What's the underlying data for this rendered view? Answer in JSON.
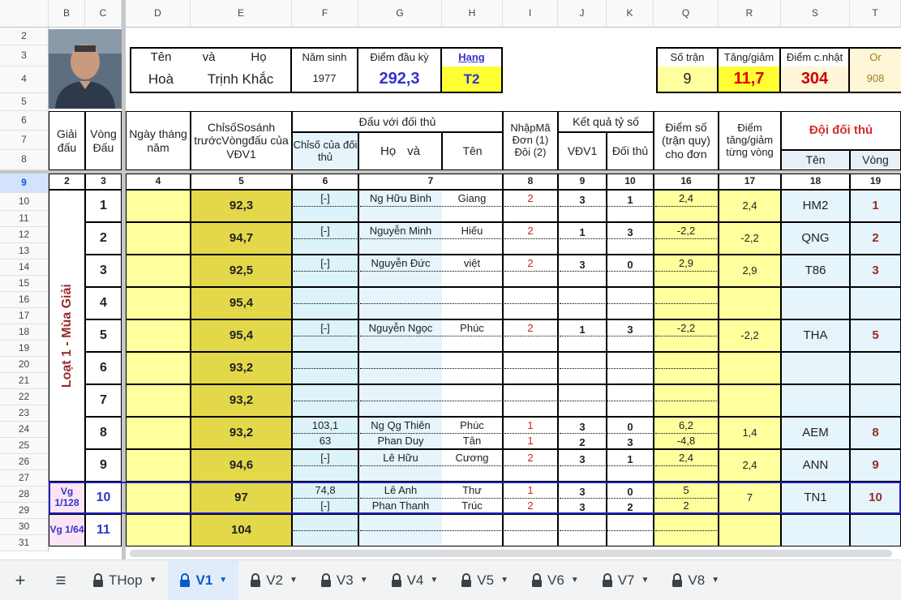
{
  "columns": [
    {
      "id": "col-b",
      "label": "B"
    },
    {
      "id": "col-c",
      "label": "C"
    },
    {
      "id": "col-d",
      "label": "D"
    },
    {
      "id": "col-e",
      "label": "E"
    },
    {
      "id": "col-f",
      "label": "F"
    },
    {
      "id": "col-g",
      "label": "G"
    },
    {
      "id": "col-h",
      "label": "H"
    },
    {
      "id": "col-i",
      "label": "I"
    },
    {
      "id": "col-j",
      "label": "J"
    },
    {
      "id": "col-k",
      "label": "K"
    },
    {
      "id": "col-q",
      "label": "Q"
    },
    {
      "id": "col-r",
      "label": "R"
    },
    {
      "id": "col-s",
      "label": "S"
    },
    {
      "id": "col-t",
      "label": "T"
    }
  ],
  "rows": [
    "2",
    "3",
    "4",
    "5",
    "6",
    "7",
    "8",
    "9",
    "10",
    "11",
    "12",
    "13",
    "14",
    "15",
    "16",
    "17",
    "18",
    "19",
    "20",
    "21",
    "22",
    "23",
    "24",
    "25",
    "26",
    "27",
    "28",
    "29",
    "30",
    "31"
  ],
  "player": {
    "name_label_ten": "Tên",
    "name_label_va": "và",
    "name_label_ho": "Họ",
    "first_name": "Hoà",
    "last_name": "Trịnh Khắc",
    "birth_year_label": "Năm sinh",
    "birth_year": "1977",
    "start_points_label": "Điểm đầu kỳ",
    "start_points": "292,3",
    "rank_label": "Hạng",
    "rank": "T2"
  },
  "summary": {
    "matches_label": "Số trận",
    "matches": "9",
    "change_label": "Tăng/giảm",
    "change": "11,7",
    "updated_label": "Điểm c.nhật",
    "updated": "304",
    "or_label": "Or",
    "or_value": "908"
  },
  "headers": {
    "giai_dau": "Giải đấu",
    "vong_dau": "Vòng Đấu",
    "ngay": "Ngày tháng năm",
    "chiso": "ChỉsốSosánh trướcVòngđấu của VĐV1",
    "dau_voi": "Đấu với đối thủ",
    "chiso_doi_thu": "Chỉsố của đối thủ",
    "ho": "Họ",
    "va": "và",
    "ten": "Tên",
    "nhap_ma": "NhậpMã Đơn (1) Đôi (2)",
    "ket_qua": "Kết quả tỷ số",
    "vdv1": "VĐV1",
    "doi_thu": "Đối thủ",
    "diem_so": "Điểm số (trận quy) cho đơn",
    "diem_tang": "Điểm tăng/giảm từng vòng",
    "doi_doi_thu": "Đội đối thủ",
    "ten_doi": "Tên",
    "vong": "Vòng"
  },
  "col_numbers": [
    "2",
    "3",
    "4",
    "5",
    "6",
    "7",
    "8",
    "9",
    "10",
    "16",
    "17",
    "18",
    "19"
  ],
  "season_label": "Loạt 1 - Mùa Giải",
  "rounds": [
    {
      "round": "1",
      "index": "92,3",
      "opp": [
        {
          "idx": "[-]",
          "ho": "Ng Hữu Bình",
          "ten": "Giang",
          "code": "2",
          "a": "3",
          "b": "1",
          "pts": "2,4"
        }
      ],
      "delta": "2,4",
      "team": "HM2",
      "vong": "1"
    },
    {
      "round": "2",
      "index": "94,7",
      "opp": [
        {
          "idx": "[-]",
          "ho": "Nguyễn Minh",
          "ten": "Hiếu",
          "code": "2",
          "a": "1",
          "b": "3",
          "pts": "-2,2"
        }
      ],
      "delta": "-2,2",
      "team": "QNG",
      "vong": "2"
    },
    {
      "round": "3",
      "index": "92,5",
      "opp": [
        {
          "idx": "[-]",
          "ho": "Nguyễn Đức",
          "ten": "việt",
          "code": "2",
          "a": "3",
          "b": "0",
          "pts": "2,9"
        }
      ],
      "delta": "2,9",
      "team": "T86",
      "vong": "3"
    },
    {
      "round": "4",
      "index": "95,4",
      "opp": [],
      "delta": "",
      "team": "",
      "vong": ""
    },
    {
      "round": "5",
      "index": "95,4",
      "opp": [
        {
          "idx": "[-]",
          "ho": "Nguyễn Ngọc",
          "ten": "Phúc",
          "code": "2",
          "a": "1",
          "b": "3",
          "pts": "-2,2"
        }
      ],
      "delta": "-2,2",
      "team": "THA",
      "vong": "5"
    },
    {
      "round": "6",
      "index": "93,2",
      "opp": [],
      "delta": "",
      "team": "",
      "vong": ""
    },
    {
      "round": "7",
      "index": "93,2",
      "opp": [],
      "delta": "",
      "team": "",
      "vong": ""
    },
    {
      "round": "8",
      "index": "93,2",
      "opp": [
        {
          "idx": "103,1",
          "ho": "Ng Qg Thiên",
          "ten": "Phúc",
          "code": "1",
          "a": "3",
          "b": "0",
          "pts": "6,2"
        },
        {
          "idx": "63",
          "ho": "Phan Duy",
          "ten": "Tân",
          "code": "1",
          "a": "2",
          "b": "3",
          "pts": "-4,8"
        }
      ],
      "delta": "1,4",
      "team": "AEM",
      "vong": "8"
    },
    {
      "round": "9",
      "index": "94,6",
      "opp": [
        {
          "idx": "[-]",
          "ho": "Lê Hữu",
          "ten": "Cương",
          "code": "2",
          "a": "3",
          "b": "1",
          "pts": "2,4"
        }
      ],
      "delta": "2,4",
      "team": "ANN",
      "vong": "9"
    }
  ],
  "playoffs": [
    {
      "label": "Vg 1/128",
      "round": "10",
      "index": "97",
      "opp": [
        {
          "idx": "74,8",
          "ho": "Lê Anh",
          "ten": "Thư",
          "code": "1",
          "a": "3",
          "b": "0",
          "pts": "5"
        },
        {
          "idx": "[-]",
          "ho": "Phan Thanh",
          "ten": "Trúc",
          "code": "2",
          "a": "3",
          "b": "2",
          "pts": "2"
        }
      ],
      "delta": "7",
      "team": "TN1",
      "vong": "10"
    },
    {
      "label": "Vg 1/64",
      "round": "11",
      "index": "104",
      "opp": [],
      "delta": "",
      "team": "",
      "vong": ""
    }
  ],
  "sheet_tabs": [
    {
      "name": "THop",
      "active": false
    },
    {
      "name": "V1",
      "active": true
    },
    {
      "name": "V2",
      "active": false
    },
    {
      "name": "V3",
      "active": false
    },
    {
      "name": "V4",
      "active": false
    },
    {
      "name": "V5",
      "active": false
    },
    {
      "name": "V6",
      "active": false
    },
    {
      "name": "V7",
      "active": false
    },
    {
      "name": "V8",
      "active": false
    }
  ],
  "toolbar": {
    "add_sheet": "+",
    "all_sheets": "≡"
  },
  "colors": {
    "yellow": "#ffff9e",
    "olive": "#e2d84a",
    "light_blue": "#ddf3fa",
    "pink": "#fbe5f4",
    "accent": "#0b57d0"
  }
}
